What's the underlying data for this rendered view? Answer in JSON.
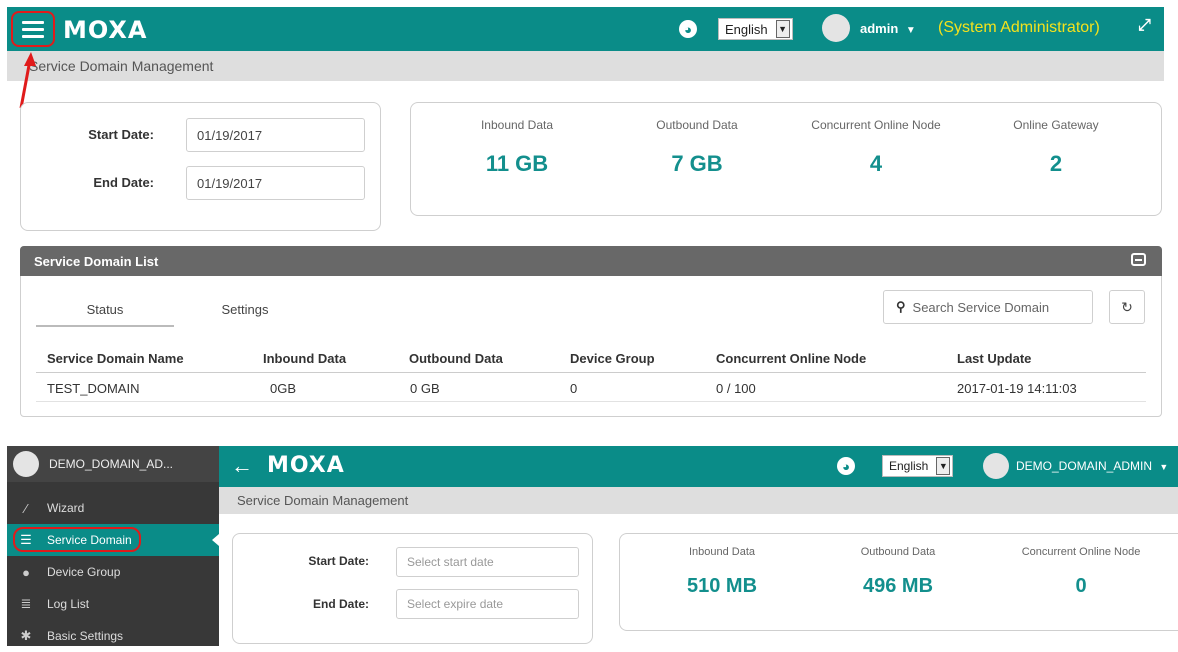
{
  "top": {
    "logo": "MOXA",
    "language": "English",
    "user": "admin",
    "role": "(System Administrator)",
    "breadcrumb": "Service Domain Management",
    "start_label": "Start Date:",
    "start_value": "01/19/2017",
    "end_label": "End Date:",
    "end_value": "01/19/2017",
    "stats": [
      {
        "label": "Inbound Data",
        "value": "11 GB"
      },
      {
        "label": "Outbound Data",
        "value": "7 GB"
      },
      {
        "label": "Concurrent Online Node",
        "value": "4"
      },
      {
        "label": "Online Gateway",
        "value": "2"
      }
    ],
    "panel_title": "Service Domain List",
    "tabs": [
      "Status",
      "Settings"
    ],
    "search_placeholder": "Search Service Domain",
    "columns": [
      "Service Domain Name",
      "Inbound Data",
      "Outbound Data",
      "Device Group",
      "Concurrent Online Node",
      "Last Update"
    ],
    "rows": [
      [
        "TEST_DOMAIN",
        "0GB",
        "0 GB",
        "0",
        "0 / 100",
        "2017-01-19 14:11:03"
      ]
    ]
  },
  "bottom": {
    "account": "DEMO_DOMAIN_AD...",
    "logo": "MOXA",
    "language": "English",
    "user": "DEMO_DOMAIN_ADMIN",
    "breadcrumb": "Service Domain Management",
    "menu": [
      {
        "label": "Wizard",
        "icon": "wand-icon"
      },
      {
        "label": "Service Domain",
        "icon": "database-icon"
      },
      {
        "label": "Device Group",
        "icon": "users-icon"
      },
      {
        "label": "Log List",
        "icon": "list-icon"
      },
      {
        "label": "Basic Settings",
        "icon": "gear-icon"
      }
    ],
    "start_label": "Start Date:",
    "start_placeholder": "Select start date",
    "end_label": "End Date:",
    "end_placeholder": "Select expire date",
    "stats": [
      {
        "label": "Inbound Data",
        "value": "510 MB"
      },
      {
        "label": "Outbound Data",
        "value": "496 MB"
      },
      {
        "label": "Concurrent Online Node",
        "value": "0"
      }
    ]
  },
  "colors": {
    "brand": "#0a8c88",
    "accent_value": "#138f8d",
    "role_text": "#f4e21c",
    "highlight": "#e01b1b"
  }
}
